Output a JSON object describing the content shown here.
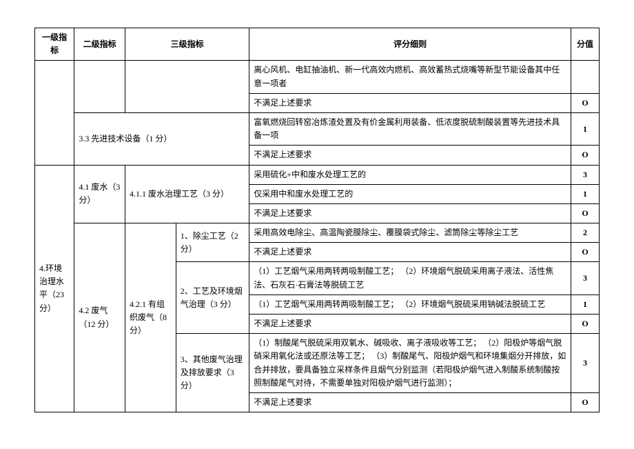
{
  "headers": {
    "l1": "一级指标",
    "l2": "二级指标",
    "l3": "三级指标",
    "rule": "评分细则",
    "score": "分值"
  },
  "section3": {
    "r0_rule": "离心风机、电缸抽油机、新一代高效内燃机、高效蓄热式烧嘴等新型节能设备其中任意一项者",
    "r1_rule": "不满足上述要求",
    "r1_score": "O",
    "item33": "3.3 先进技术设备（1 分）",
    "r2_rule": "富氧燃烧回转窑冶炼渣处置及有价金属利用装备、低浓度脱硫制酸装置等先进技术具备一项",
    "r2_score": "1",
    "r3_rule": "不满足上述要求",
    "r3_score": "O"
  },
  "section4": {
    "l1": "4.环境治理水平（23分）",
    "item41": {
      "label": "4.1 废水（3分）",
      "sub411": "4.1.1 废水治理工艺（3 分）",
      "r0_rule": "采用硫化+中和废水处理工艺的",
      "r0_score": "3",
      "r1_rule": "仅采用中和废水处理工艺的",
      "r1_score": "1",
      "r2_rule": "不满足上述要求",
      "r2_score": "O"
    },
    "item42": {
      "label": "4.2 废气（12 分）",
      "sub421": "4.2.1 有组织废气（8 分）",
      "g1_label": "1、除尘工艺（2 分）",
      "g1_r0_rule": "采用高效电除尘、高温陶瓷膜除尘、覆膜袋式除尘、滤筒除尘等除尘工艺",
      "g1_r0_score": "2",
      "g1_r1_rule": "不满足上述要求",
      "g1_r1_score": "O",
      "g2_label": "2、工艺及环境烟气治理（3 分）",
      "g2_r0_rule": "（1）工艺烟气采用两转两吸制酸工艺；\n（2）环境烟气脱硫采用离子液法、活性焦法、石灰石·石膏法等脱硫工艺",
      "g2_r0_score": "3",
      "g2_r1_rule": "（1）工艺烟气采用两转两吸制酸工艺；\n（2）环境烟气脱硫采用钠碱法脱硫工艺",
      "g2_r1_score": "1",
      "g2_r2_rule": "不满足上述要求",
      "g2_r2_score": "O",
      "g3_label": "3、其他废气治理及排放要求（3 分）",
      "g3_r0_rule": "（1）制酸尾气脱硫采用双氧水、碱吸收、离子液吸收等工艺；\n（2）阳极炉等烟气脱硝采用氧化法或还原法等工艺；\n（3）制酸尾气、阳极炉烟气和环境集烟分开排放，如合并排放，要具备独立采样条件且烟气分别监测（若阳极炉烟气进入制酸系统制酸按照制酸尾气对待，不需要单独对阳极炉烟气进行监测）；",
      "g3_r0_score": "3",
      "g3_r1_rule": "不满足上述要求",
      "g3_r1_score": "O"
    }
  }
}
